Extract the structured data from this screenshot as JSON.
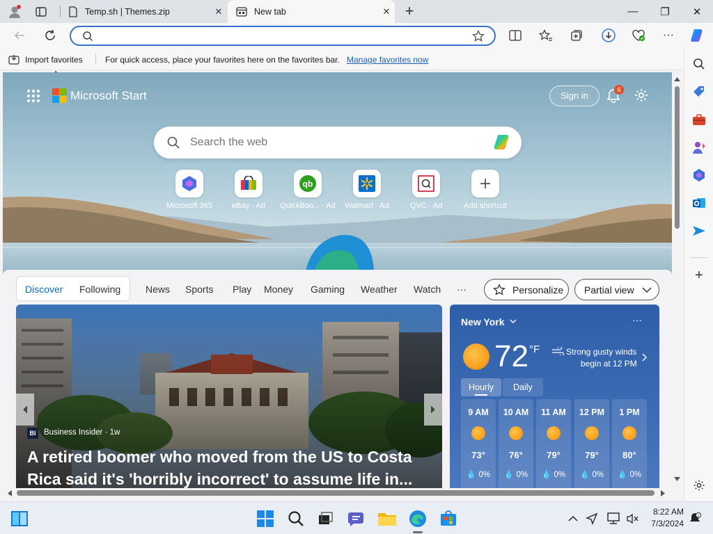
{
  "tabs": [
    {
      "title": "Temp.sh | Themes.zip",
      "close": "✕"
    },
    {
      "title": "New tab",
      "close": "✕"
    }
  ],
  "new_tab_symbol": "+",
  "window_controls": {
    "minimize": "—",
    "restore": "❐",
    "close": "✕"
  },
  "address_bar": {
    "value": ""
  },
  "favorites_bar": {
    "import_label": "Import favorites",
    "message": "For quick access, place your favorites here on the favorites bar.",
    "manage_link": "Manage favorites now"
  },
  "header": {
    "brand": "Microsoft Start",
    "sign_in": "Sign in",
    "notification_count": "6"
  },
  "search": {
    "placeholder": "Search the web"
  },
  "shortcuts": [
    {
      "label": "Microsoft 365",
      "icon": "microsoft-365-icon"
    },
    {
      "label": "eBay · Ad",
      "icon": "ebay-icon"
    },
    {
      "label": "QuickBoo... · Ad",
      "icon": "quickbooks-icon"
    },
    {
      "label": "Walmart · Ad",
      "icon": "walmart-icon"
    },
    {
      "label": "QVC · Ad",
      "icon": "qvc-icon"
    },
    {
      "label": "Add shortcut",
      "icon": "plus-icon"
    }
  ],
  "feed_tabs": {
    "discover": "Discover",
    "following": "Following",
    "items": [
      "News",
      "Sports",
      "Play",
      "Money",
      "Gaming",
      "Weather",
      "Watch"
    ],
    "more": "···",
    "personalize": "Personalize",
    "view": "Partial view"
  },
  "headline": {
    "source_badge": "BI",
    "source": "Business Insider · 1w",
    "title": "A retired boomer who moved from the US to Costa Rica said it's 'horribly incorrect' to assume life in..."
  },
  "weather": {
    "location": "New York",
    "temp": "72",
    "unit": "°F",
    "alert_line1": "Strong gusty winds",
    "alert_line2": "begin at 12 PM",
    "tab_hourly": "Hourly",
    "tab_daily": "Daily",
    "hours": [
      {
        "time": "9 AM",
        "temp": "73°",
        "rain": "0%"
      },
      {
        "time": "10 AM",
        "temp": "76°",
        "rain": "0%"
      },
      {
        "time": "11 AM",
        "temp": "79°",
        "rain": "0%"
      },
      {
        "time": "12 PM",
        "temp": "79°",
        "rain": "0%"
      },
      {
        "time": "1 PM",
        "temp": "80°",
        "rain": "0%"
      }
    ]
  },
  "taskbar": {
    "time": "8:22 AM",
    "date": "7/3/2024"
  },
  "colors": {
    "accent": "#0f6cbd",
    "link": "#1a5fb4",
    "weather_bg": "#3d6cb5"
  }
}
